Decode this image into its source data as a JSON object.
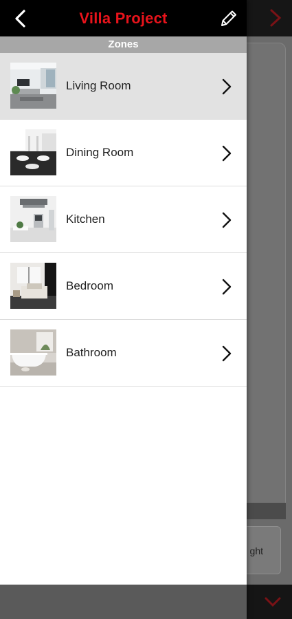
{
  "header": {
    "title": "Villa Project",
    "back_icon": "chevron-left-icon",
    "edit_icon": "pencil-icon",
    "title_color": "#e8131b"
  },
  "section": {
    "title": "Zones"
  },
  "zones": [
    {
      "label": "Living Room",
      "image": "living-room-thumbnail",
      "selected": true
    },
    {
      "label": "Dining Room",
      "image": "dining-room-thumbnail",
      "selected": false
    },
    {
      "label": "Kitchen",
      "image": "kitchen-thumbnail",
      "selected": false
    },
    {
      "label": "Bedroom",
      "image": "bedroom-thumbnail",
      "selected": false
    },
    {
      "label": "Bathroom",
      "image": "bathroom-thumbnail",
      "selected": false
    }
  ],
  "background": {
    "button_label": "ght",
    "next_icon": "chevron-right-icon",
    "down_icon": "chevron-down-icon",
    "accent_color": "#8a1115"
  }
}
